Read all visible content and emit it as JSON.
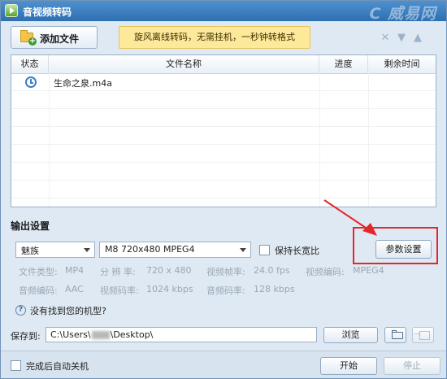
{
  "window": {
    "title": "音视频转码",
    "watermark": "C 威易网"
  },
  "toolbar": {
    "add_file_label": "添加文件",
    "promo_text": "旋风离线转码，无需挂机，一秒钟转格式",
    "icons": [
      "close-icon",
      "move-down-icon",
      "move-up-icon"
    ]
  },
  "table": {
    "headers": {
      "status": "状态",
      "filename": "文件名称",
      "progress": "进度",
      "remaining": "剩余时间"
    },
    "rows": [
      {
        "status_icon": "clock-icon",
        "filename": "生命之泉.m4a",
        "progress": "",
        "remaining": ""
      }
    ]
  },
  "output": {
    "section_title": "输出设置",
    "brand_select": "魅族",
    "model_select": "M8 720x480 MPEG4",
    "keep_ratio_label": "保持长宽比",
    "keep_ratio_checked": false,
    "param_button": "参数设置",
    "info_row1": [
      {
        "label": "文件类型:",
        "value": "MP4"
      },
      {
        "label": "分 辨 率:",
        "value": "720 x 480"
      },
      {
        "label": "视频帧率:",
        "value": "24.0 fps"
      },
      {
        "label": "视频编码:",
        "value": "MPEG4"
      }
    ],
    "info_row2": [
      {
        "label": "音频编码:",
        "value": "AAC"
      },
      {
        "label": "视频码率:",
        "value": "1024 kbps"
      },
      {
        "label": "音频码率:",
        "value": "128 kbps"
      }
    ],
    "help_link": "没有找到您的机型?"
  },
  "save": {
    "label": "保存到:",
    "path_prefix": "C:\\Users\\",
    "path_suffix": "\\Desktop\\",
    "browse_label": "浏览"
  },
  "footer": {
    "auto_shutdown_label": "完成后自动关机",
    "auto_shutdown_checked": false,
    "start_label": "开始",
    "stop_label": "停止"
  },
  "colors": {
    "accent_red": "#e3262a",
    "title_blue": "#2e6fb1",
    "promo_yellow": "#fde99a"
  }
}
